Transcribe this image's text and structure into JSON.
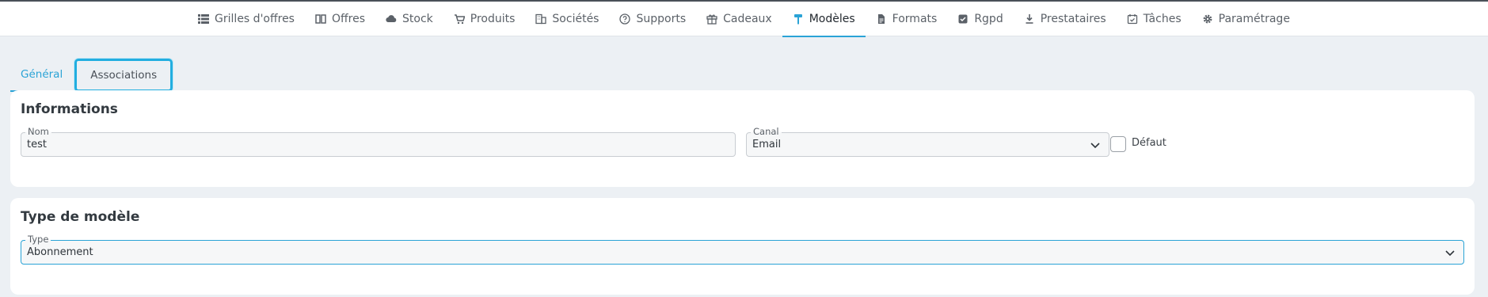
{
  "nav": {
    "items": [
      {
        "label": "Grilles d'offres",
        "icon": "grid-icon"
      },
      {
        "label": "Offres",
        "icon": "book-icon"
      },
      {
        "label": "Stock",
        "icon": "cloud-icon"
      },
      {
        "label": "Produits",
        "icon": "cart-icon"
      },
      {
        "label": "Sociétés",
        "icon": "building-icon"
      },
      {
        "label": "Supports",
        "icon": "help-circle-icon"
      },
      {
        "label": "Cadeaux",
        "icon": "gift-icon"
      },
      {
        "label": "Modèles",
        "icon": "paint-roller-icon"
      },
      {
        "label": "Formats",
        "icon": "file-icon"
      },
      {
        "label": "Rgpd",
        "icon": "check-badge-icon"
      },
      {
        "label": "Prestataires",
        "icon": "download-icon"
      },
      {
        "label": "Tâches",
        "icon": "calendar-check-icon"
      },
      {
        "label": "Paramétrage",
        "icon": "gear-icon"
      }
    ],
    "active": "Modèles",
    "accent": "#2aa3d6"
  },
  "tabs": {
    "general": "Général",
    "associations": "Associations"
  },
  "informations": {
    "title": "Informations",
    "nom_label": "Nom",
    "nom_value": "test",
    "canal_label": "Canal",
    "canal_value": "Email",
    "defaut_label": "Défaut"
  },
  "type_modele": {
    "title": "Type de modèle",
    "type_label": "Type",
    "type_value": "Abonnement"
  }
}
